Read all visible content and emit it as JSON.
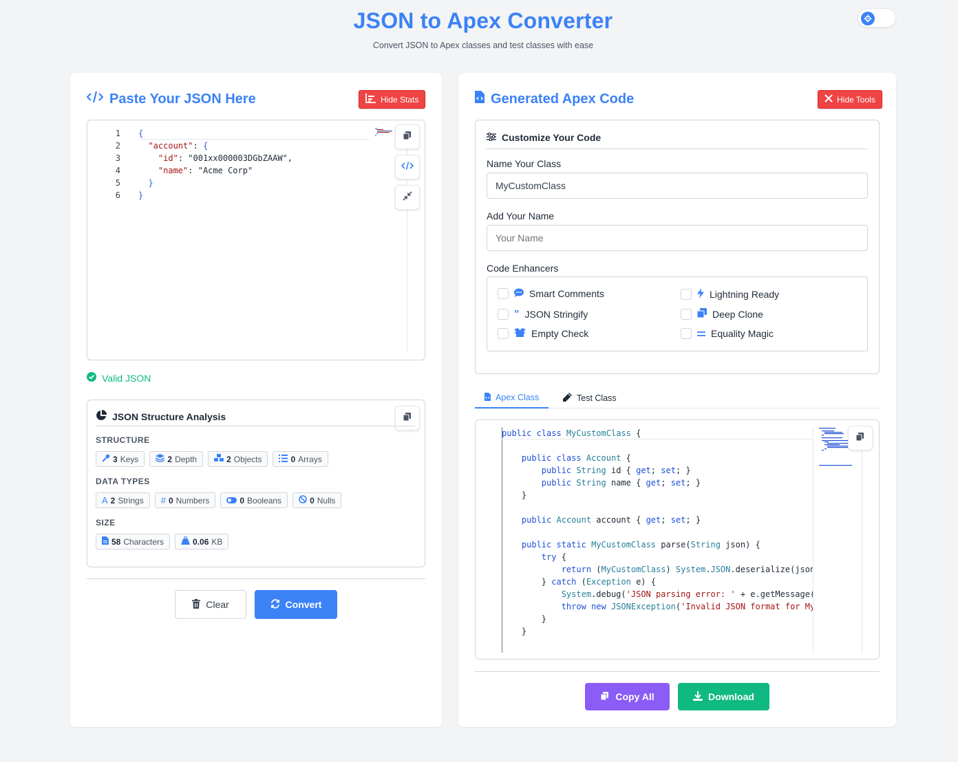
{
  "header": {
    "title": "JSON to Apex Converter",
    "subtitle": "Convert JSON to Apex classes and test classes with ease"
  },
  "colors": {
    "accent": "#3b82f6",
    "danger": "#ef4444",
    "success": "#10b981",
    "purple": "#8b5cf6"
  },
  "left_panel": {
    "title": "Paste Your JSON Here",
    "hide_stats_label": "Hide Stats",
    "editor": {
      "line_numbers": [
        "1",
        "2",
        "3",
        "4",
        "5",
        "6"
      ],
      "lines": [
        "{",
        "  \"account\": {",
        "    \"id\": \"001xx000003DGbZAAW\",",
        "    \"name\": \"Acme Corp\"",
        "  }",
        "}"
      ]
    },
    "valid_text": "Valid JSON",
    "analysis": {
      "title": "JSON Structure Analysis",
      "structure_label": "STRUCTURE",
      "structure": [
        {
          "icon": "key-icon",
          "value": "3",
          "label": "Keys"
        },
        {
          "icon": "layers-icon",
          "value": "2",
          "label": "Depth"
        },
        {
          "icon": "cubes-icon",
          "value": "2",
          "label": "Objects"
        },
        {
          "icon": "list-icon",
          "value": "0",
          "label": "Arrays"
        }
      ],
      "data_types_label": "DATA TYPES",
      "data_types": [
        {
          "icon": "font-icon",
          "value": "2",
          "label": "Strings"
        },
        {
          "icon": "hash-icon",
          "value": "0",
          "label": "Numbers"
        },
        {
          "icon": "toggle-icon",
          "value": "0",
          "label": "Booleans"
        },
        {
          "icon": "ban-icon",
          "value": "0",
          "label": "Nulls"
        }
      ],
      "size_label": "SIZE",
      "size": [
        {
          "icon": "file-icon",
          "value": "58",
          "label": "Characters"
        },
        {
          "icon": "weight-icon",
          "value": "0.06",
          "label": "KB"
        }
      ]
    },
    "clear_label": "Clear",
    "convert_label": "Convert"
  },
  "right_panel": {
    "title": "Generated Apex Code",
    "hide_tools_label": "Hide Tools",
    "customize": {
      "title": "Customize Your Code",
      "class_name_label": "Name Your Class",
      "class_name_value": "MyCustomClass",
      "author_label": "Add Your Name",
      "author_placeholder": "Your Name",
      "enhancers_label": "Code Enhancers",
      "enhancers": [
        {
          "icon": "comment-icon",
          "label": "Smart Comments",
          "checked": false
        },
        {
          "icon": "bolt-icon",
          "label": "Lightning Ready",
          "checked": false
        },
        {
          "icon": "quote-icon",
          "label": "JSON Stringify",
          "checked": false
        },
        {
          "icon": "clone-icon",
          "label": "Deep Clone",
          "checked": false
        },
        {
          "icon": "box-open-icon",
          "label": "Empty Check",
          "checked": false
        },
        {
          "icon": "equals-icon",
          "label": "Equality Magic",
          "checked": false
        }
      ]
    },
    "tabs": {
      "apex": "Apex Class",
      "test": "Test Class"
    },
    "code_lines": [
      "public class MyCustomClass {",
      "",
      "    public class Account {",
      "        public String id { get; set; }",
      "        public String name { get; set; }",
      "    }",
      "",
      "    public Account account { get; set; }",
      "",
      "    public static MyCustomClass parse(String json) {",
      "        try {",
      "            return (MyCustomClass) System.JSON.deserialize(json, MyCustomClass.class);",
      "        } catch (Exception e) {",
      "            System.debug('JSON parsing error: ' + e.getMessage());",
      "            throw new JSONException('Invalid JSON format for MyCustomClass');",
      "        }",
      "    }"
    ],
    "copy_all_label": "Copy All",
    "download_label": "Download"
  }
}
